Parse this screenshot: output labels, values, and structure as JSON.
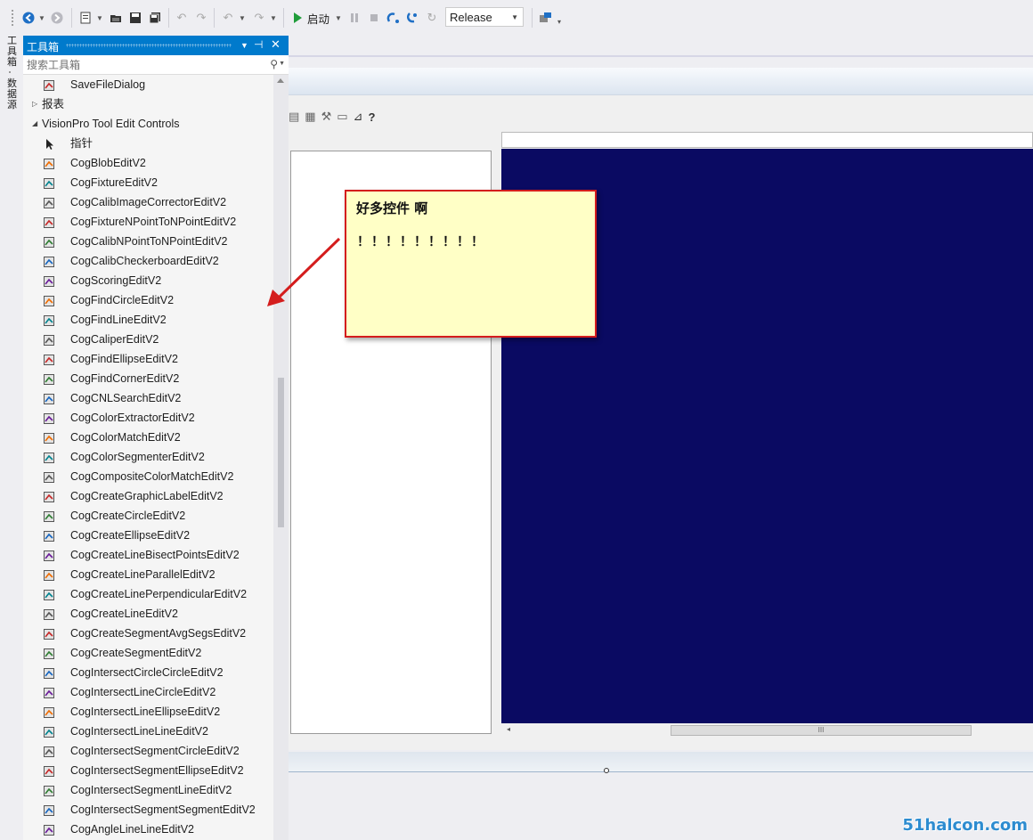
{
  "toolbar": {
    "start_label": "启动",
    "config_value": "Release",
    "colors": {
      "start_green": "#1f9c3a",
      "nav_blue": "#1f6fc5"
    }
  },
  "side_strip": {
    "tab1": "工具箱",
    "tab2": "数据源"
  },
  "toolbox": {
    "title": "工具箱",
    "search_placeholder": "搜索工具箱",
    "items": [
      {
        "kind": "item",
        "label": "SaveFileDialog",
        "icon": "save-dialog-icon"
      },
      {
        "kind": "category",
        "label": "报表",
        "expanded": false
      },
      {
        "kind": "category",
        "label": "VisionPro Tool Edit Controls",
        "expanded": true
      },
      {
        "kind": "item",
        "label": "指针",
        "icon": "pointer-icon"
      },
      {
        "kind": "item",
        "label": "CogBlobEditV2",
        "icon": "blob-tool-icon"
      },
      {
        "kind": "item",
        "label": "CogFixtureEditV2",
        "icon": "fixture-tool-icon"
      },
      {
        "kind": "item",
        "label": "CogCalibImageCorrectorEditV2",
        "icon": "calib-corrector-icon"
      },
      {
        "kind": "item",
        "label": "CogFixtureNPointToNPointEditV2",
        "icon": "npoint-fixture-icon"
      },
      {
        "kind": "item",
        "label": "CogCalibNPointToNPointEditV2",
        "icon": "npoint-calib-icon"
      },
      {
        "kind": "item",
        "label": "CogCalibCheckerboardEditV2",
        "icon": "checkerboard-icon"
      },
      {
        "kind": "item",
        "label": "CogScoringEditV2",
        "icon": "scoring-icon"
      },
      {
        "kind": "item",
        "label": "CogFindCircleEditV2",
        "icon": "find-circle-icon"
      },
      {
        "kind": "item",
        "label": "CogFindLineEditV2",
        "icon": "find-line-icon"
      },
      {
        "kind": "item",
        "label": "CogCaliperEditV2",
        "icon": "caliper-icon"
      },
      {
        "kind": "item",
        "label": "CogFindEllipseEditV2",
        "icon": "find-ellipse-icon"
      },
      {
        "kind": "item",
        "label": "CogFindCornerEditV2",
        "icon": "find-corner-icon"
      },
      {
        "kind": "item",
        "label": "CogCNLSearchEditV2",
        "icon": "cnl-search-icon"
      },
      {
        "kind": "item",
        "label": "CogColorExtractorEditV2",
        "icon": "color-extractor-icon"
      },
      {
        "kind": "item",
        "label": "CogColorMatchEditV2",
        "icon": "color-match-icon"
      },
      {
        "kind": "item",
        "label": "CogColorSegmenterEditV2",
        "icon": "color-segmenter-icon"
      },
      {
        "kind": "item",
        "label": "CogCompositeColorMatchEditV2",
        "icon": "composite-color-icon"
      },
      {
        "kind": "item",
        "label": "CogCreateGraphicLabelEditV2",
        "icon": "graphic-label-icon"
      },
      {
        "kind": "item",
        "label": "CogCreateCircleEditV2",
        "icon": "create-circle-icon"
      },
      {
        "kind": "item",
        "label": "CogCreateEllipseEditV2",
        "icon": "create-ellipse-icon"
      },
      {
        "kind": "item",
        "label": "CogCreateLineBisectPointsEditV2",
        "icon": "line-bisect-icon"
      },
      {
        "kind": "item",
        "label": "CogCreateLineParallelEditV2",
        "icon": "line-parallel-icon"
      },
      {
        "kind": "item",
        "label": "CogCreateLinePerpendicularEditV2",
        "icon": "line-perpendicular-icon"
      },
      {
        "kind": "item",
        "label": "CogCreateLineEditV2",
        "icon": "create-line-icon"
      },
      {
        "kind": "item",
        "label": "CogCreateSegmentAvgSegsEditV2",
        "icon": "segment-avg-icon"
      },
      {
        "kind": "item",
        "label": "CogCreateSegmentEditV2",
        "icon": "create-segment-icon"
      },
      {
        "kind": "item",
        "label": "CogIntersectCircleCircleEditV2",
        "icon": "intersect-cc-icon"
      },
      {
        "kind": "item",
        "label": "CogIntersectLineCircleEditV2",
        "icon": "intersect-lc-icon"
      },
      {
        "kind": "item",
        "label": "CogIntersectLineEllipseEditV2",
        "icon": "intersect-le-icon"
      },
      {
        "kind": "item",
        "label": "CogIntersectLineLineEditV2",
        "icon": "intersect-ll-icon"
      },
      {
        "kind": "item",
        "label": "CogIntersectSegmentCircleEditV2",
        "icon": "intersect-sc-icon"
      },
      {
        "kind": "item",
        "label": "CogIntersectSegmentEllipseEditV2",
        "icon": "intersect-se-icon"
      },
      {
        "kind": "item",
        "label": "CogIntersectSegmentLineEditV2",
        "icon": "intersect-sl-icon"
      },
      {
        "kind": "item",
        "label": "CogIntersectSegmentSegmentEditV2",
        "icon": "intersect-ss-icon"
      },
      {
        "kind": "item",
        "label": "CogAngleLineLineEditV2",
        "icon": "angle-ll-icon"
      }
    ]
  },
  "designer": {
    "display_color": "#0a0a62",
    "scroll_thumb_glyph": "III"
  },
  "note": {
    "title": "好多控件 啊",
    "body": "！！！！！！！！！",
    "border_color": "#d41d1d",
    "bg_color": "#ffffc6"
  },
  "watermark": "51halcon.com"
}
